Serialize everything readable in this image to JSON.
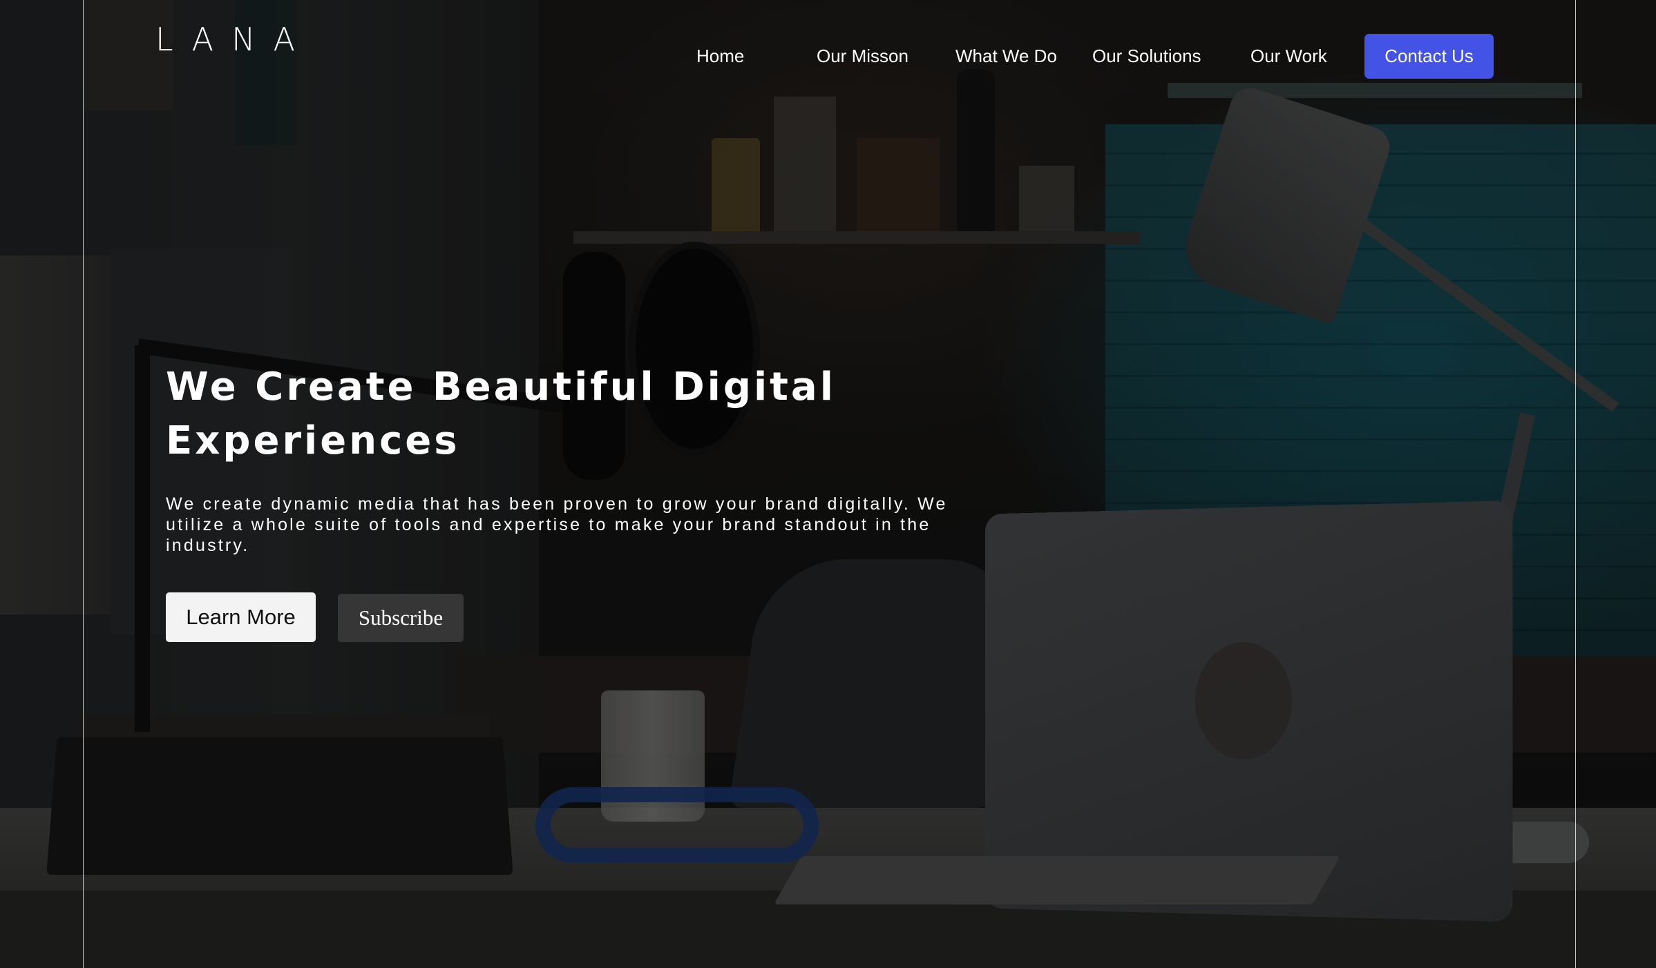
{
  "brand": {
    "logo_text": "LANA"
  },
  "nav": {
    "items": [
      {
        "label": "Home"
      },
      {
        "label": "Our Misson"
      },
      {
        "label": "What We Do"
      },
      {
        "label": "Our Solutions"
      },
      {
        "label": "Our Work"
      }
    ],
    "contact_label": "Contact Us"
  },
  "hero": {
    "title": "We Create Beautiful Digital Experiences",
    "subtitle": "We create dynamic media that has been proven to grow your brand digitally. We utilize a whole suite of tools and expertise to make your brand standout in the industry.",
    "primary_button": "Learn More",
    "secondary_button": "Subscribe"
  },
  "colors": {
    "accent": "#4353e6",
    "primary_button_bg": "#f3f3f3",
    "secondary_button_bg": "#363636",
    "text": "#ffffff"
  }
}
